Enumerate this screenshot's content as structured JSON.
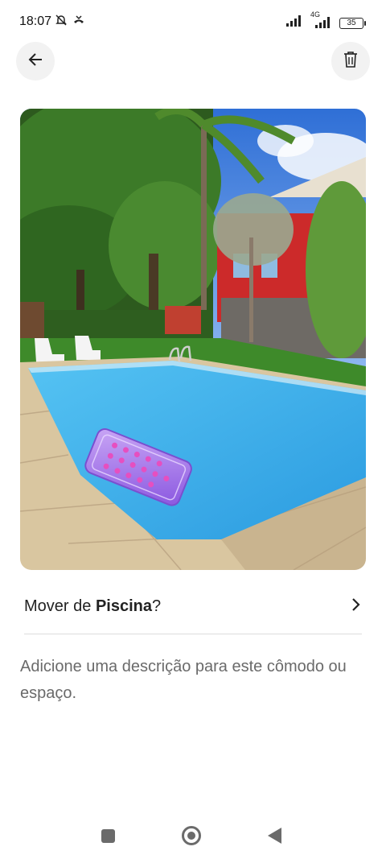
{
  "status_bar": {
    "time": "18:07",
    "network": "4G",
    "battery": "35"
  },
  "header": {
    "back_icon": "arrow-left-icon",
    "delete_icon": "trash-icon"
  },
  "photo": {
    "subject": "swimming pool photo"
  },
  "move": {
    "prefix": "Mover de ",
    "room": "Piscina",
    "suffix": "?"
  },
  "description": {
    "placeholder": "Adicione uma descrição para este cômodo ou espaço."
  },
  "colors": {
    "pool": "#3aaee8",
    "sky": "#3d7fe0",
    "house": "#cc2a2a",
    "grass": "#3e8a2a"
  }
}
